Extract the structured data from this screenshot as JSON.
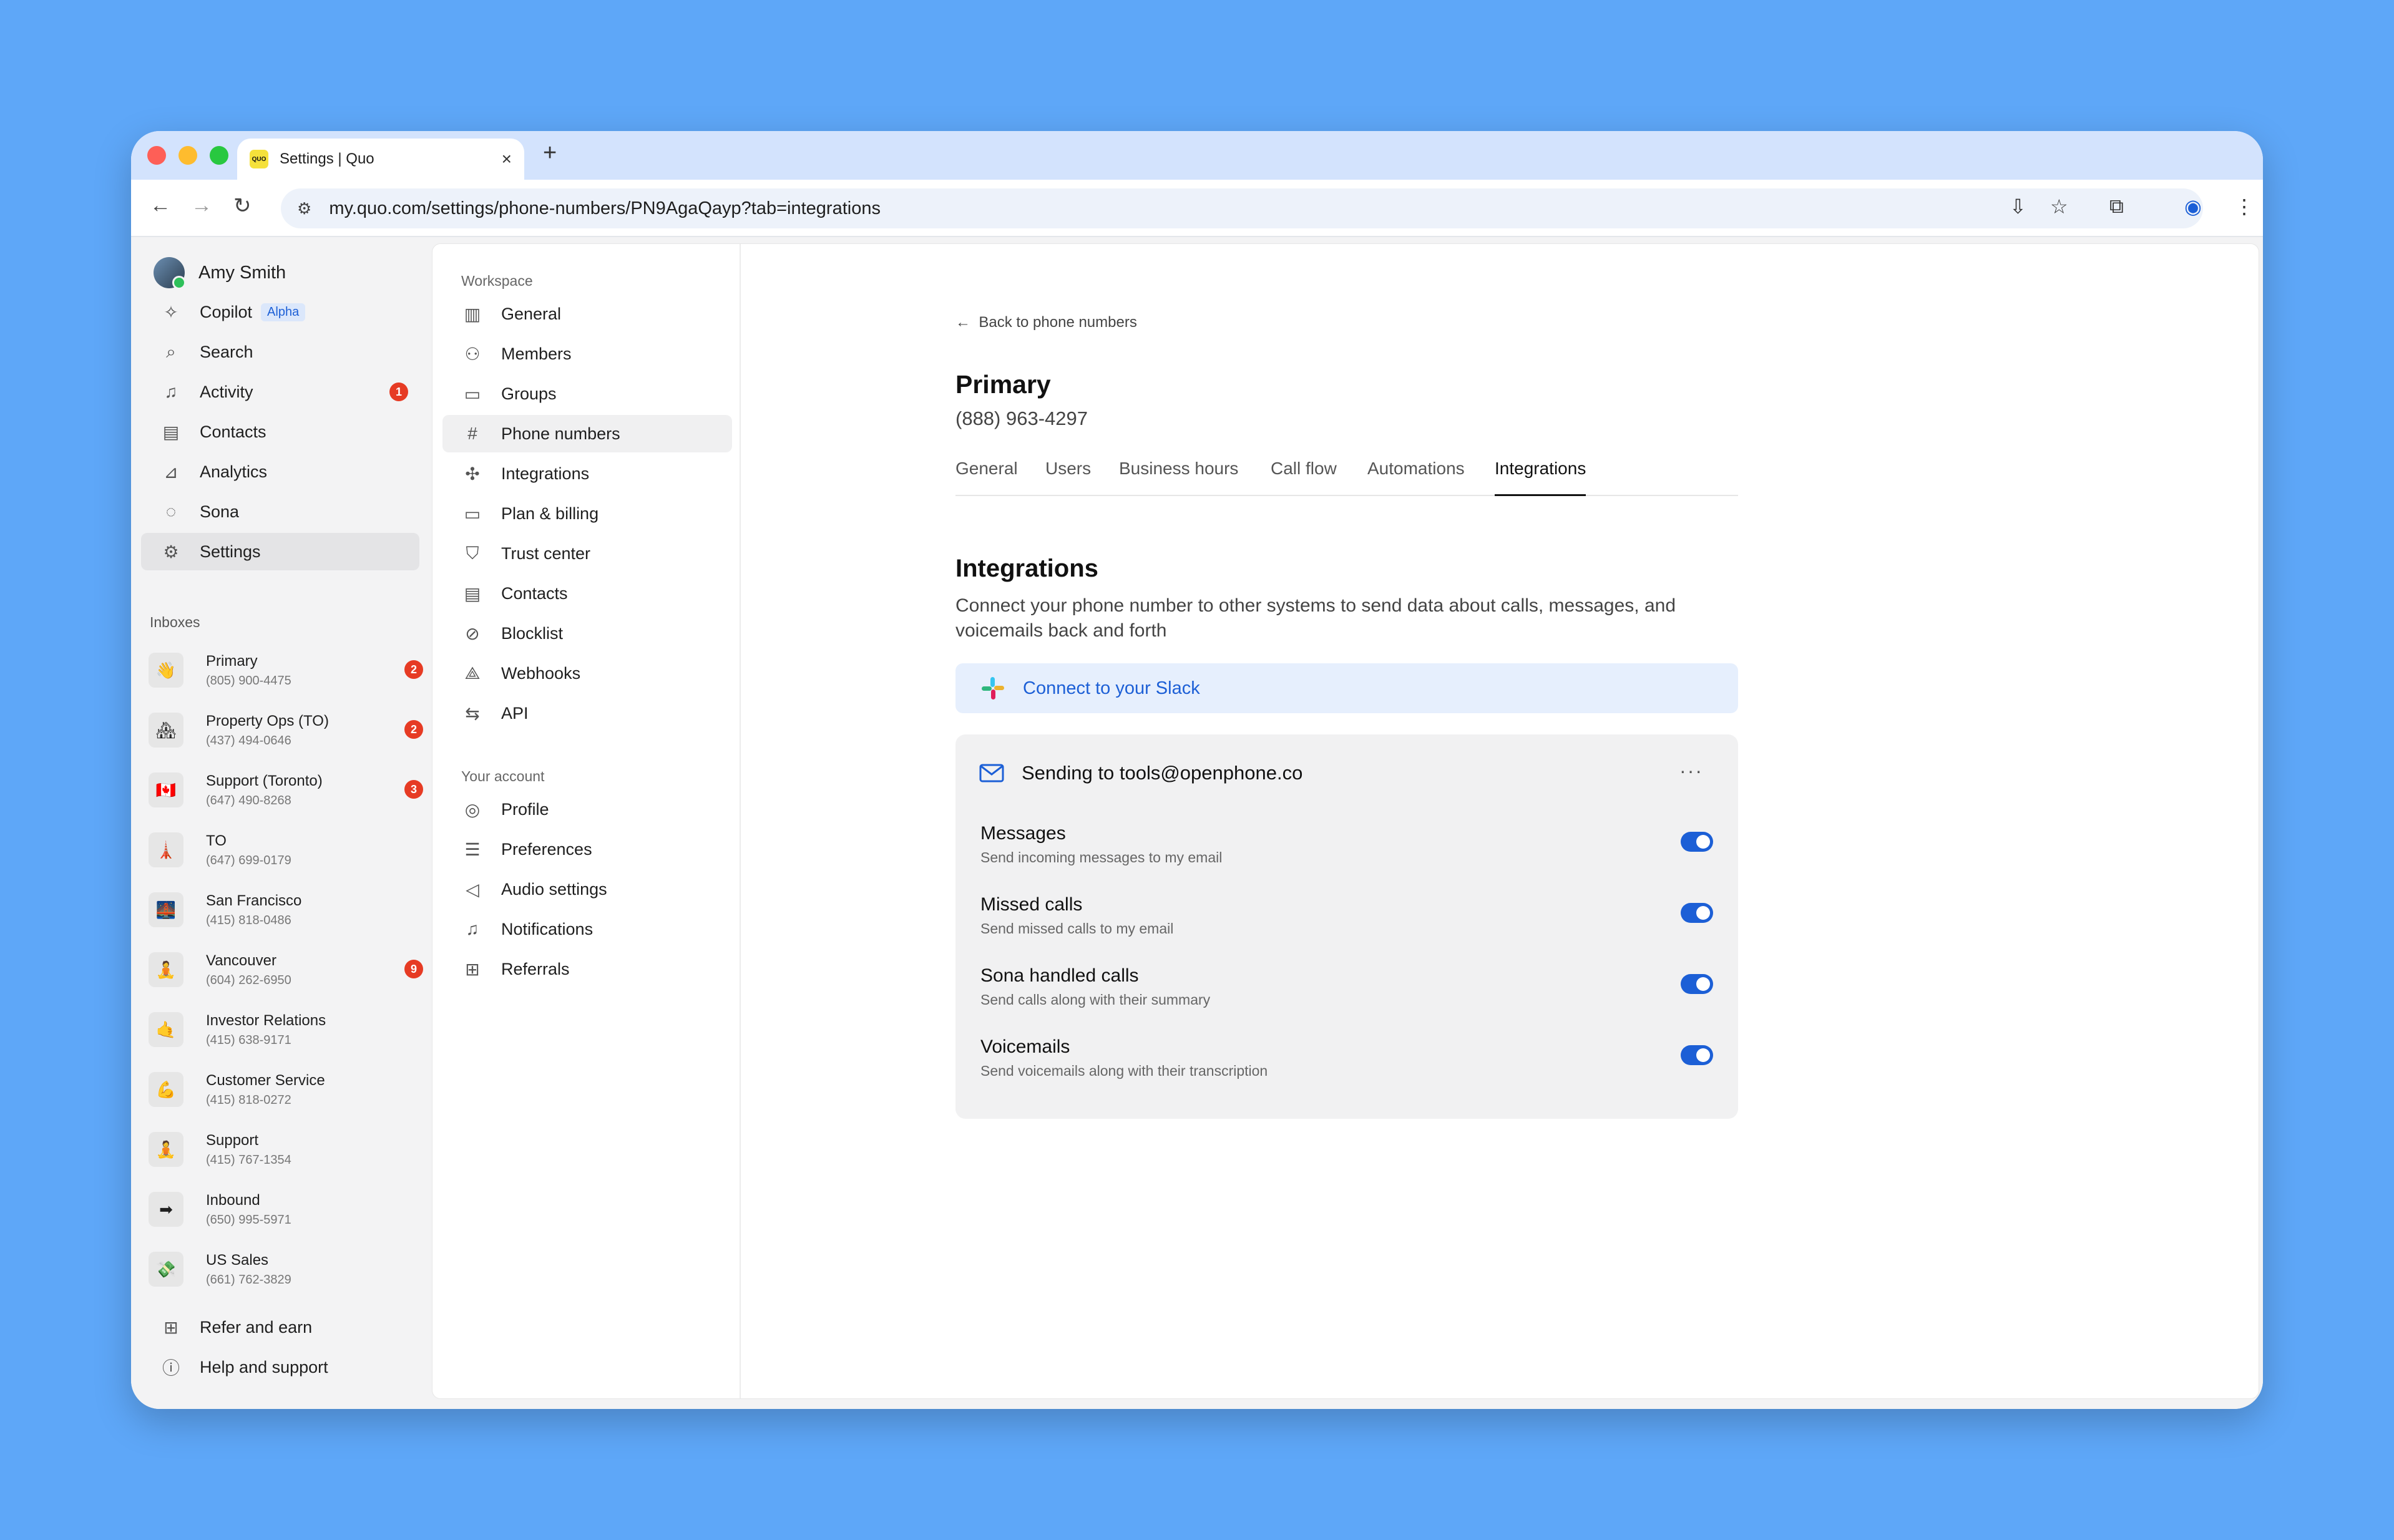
{
  "browser": {
    "tab_title": "Settings | Quo",
    "favicon_text": "QUO",
    "url": "my.quo.com/settings/phone-numbers/PN9AgaQayp?tab=integrations"
  },
  "sidebar": {
    "user_name": "Amy Smith",
    "items": [
      {
        "label": "Copilot",
        "icon": "sparkle-icon",
        "tag": "Alpha"
      },
      {
        "label": "Search",
        "icon": "search-icon"
      },
      {
        "label": "Activity",
        "icon": "bell-icon",
        "badge": "1"
      },
      {
        "label": "Contacts",
        "icon": "contacts-icon"
      },
      {
        "label": "Analytics",
        "icon": "analytics-icon"
      },
      {
        "label": "Sona",
        "icon": "sona-icon"
      },
      {
        "label": "Settings",
        "icon": "gear-icon"
      }
    ],
    "inboxes_heading": "Inboxes",
    "inboxes": [
      {
        "name": "Primary",
        "phone": "(805) 900-4475",
        "badge": "2",
        "emoji": "👋"
      },
      {
        "name": "Property Ops (TO)",
        "phone": "(437) 494-0646",
        "badge": "2",
        "emoji": "🏘"
      },
      {
        "name": "Support (Toronto)",
        "phone": "(647) 490-8268",
        "badge": "3",
        "emoji": "🇨🇦"
      },
      {
        "name": "TO",
        "phone": "(647) 699-0179",
        "badge": "",
        "emoji": "🗼"
      },
      {
        "name": "San Francisco",
        "phone": "(415) 818-0486",
        "badge": "",
        "emoji": "🌉"
      },
      {
        "name": "Vancouver",
        "phone": "(604) 262-6950",
        "badge": "9",
        "emoji": "🧘"
      },
      {
        "name": "Investor Relations",
        "phone": "(415) 638-9171",
        "badge": "",
        "emoji": "🤙"
      },
      {
        "name": "Customer Service",
        "phone": "(415) 818-0272",
        "badge": "",
        "emoji": "💪"
      },
      {
        "name": "Support",
        "phone": "(415) 767-1354",
        "badge": "",
        "emoji": "🧘"
      },
      {
        "name": "Inbound",
        "phone": "(650) 995-5971",
        "badge": "",
        "emoji": "➡"
      },
      {
        "name": "US Sales",
        "phone": "(661) 762-3829",
        "badge": "",
        "emoji": "💸"
      }
    ],
    "footer": [
      {
        "label": "Refer and earn",
        "icon": "gift-icon"
      },
      {
        "label": "Help and support",
        "icon": "help-icon"
      }
    ]
  },
  "settings_nav": {
    "workspace_heading": "Workspace",
    "workspace": [
      {
        "label": "General",
        "icon": "building-icon"
      },
      {
        "label": "Members",
        "icon": "members-icon"
      },
      {
        "label": "Groups",
        "icon": "folder-icon"
      },
      {
        "label": "Phone numbers",
        "icon": "hash-icon"
      },
      {
        "label": "Integrations",
        "icon": "integrations-icon"
      },
      {
        "label": "Plan & billing",
        "icon": "card-icon"
      },
      {
        "label": "Trust center",
        "icon": "shield-icon"
      },
      {
        "label": "Contacts",
        "icon": "contacts-icon"
      },
      {
        "label": "Blocklist",
        "icon": "block-icon"
      },
      {
        "label": "Webhooks",
        "icon": "webhook-icon"
      },
      {
        "label": "API",
        "icon": "api-icon"
      }
    ],
    "account_heading": "Your account",
    "account": [
      {
        "label": "Profile",
        "icon": "profile-icon"
      },
      {
        "label": "Preferences",
        "icon": "sliders-icon"
      },
      {
        "label": "Audio settings",
        "icon": "speaker-icon"
      },
      {
        "label": "Notifications",
        "icon": "bell-icon"
      },
      {
        "label": "Referrals",
        "icon": "gift-icon"
      }
    ]
  },
  "main": {
    "back_label": "Back to phone numbers",
    "title": "Primary",
    "phone": "(888) 963-4297",
    "tabs": [
      "General",
      "Users",
      "Business hours",
      "Call flow",
      "Automations",
      "Integrations"
    ],
    "active_tab": "Integrations",
    "section_title": "Integrations",
    "section_desc": "Connect your phone number to other systems to send data about calls, messages, and voicemails back and forth",
    "slack_label": "Connect to your Slack",
    "email_card": {
      "title": "Sending to tools@openphone.co",
      "rows": [
        {
          "title": "Messages",
          "subtitle": "Send incoming messages to my email",
          "enabled": true
        },
        {
          "title": "Missed calls",
          "subtitle": "Send missed calls to my email",
          "enabled": true
        },
        {
          "title": "Sona handled calls",
          "subtitle": "Send calls along with their summary",
          "enabled": true
        },
        {
          "title": "Voicemails",
          "subtitle": "Send voicemails along with their transcription",
          "enabled": true
        }
      ]
    }
  },
  "colors": {
    "accent": "#1c5fd6",
    "badge": "#e63b24",
    "background": "#5ea7f8"
  }
}
